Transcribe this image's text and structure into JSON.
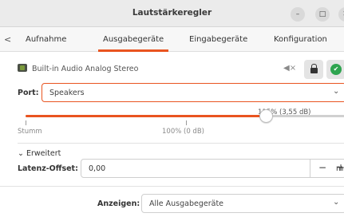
{
  "window": {
    "title": "Lautstärkeregler",
    "minimize_icon": "–",
    "maximize_icon": "□",
    "close_icon": "✕"
  },
  "tabs": {
    "scroll_left": "<",
    "items": [
      {
        "label": "Aufnahme"
      },
      {
        "label": "Ausgabegeräte",
        "active": true
      },
      {
        "label": "Eingabegeräte"
      },
      {
        "label": "Konfiguration"
      }
    ]
  },
  "device": {
    "name": "Built-in Audio Analog Stereo",
    "mute_icon": "speaker-muted-icon",
    "lock_icon": "lock-icon",
    "default_icon": "check-icon",
    "check_glyph": "✔"
  },
  "port": {
    "label": "Port:",
    "value": "Speakers",
    "chevron": "⌄"
  },
  "volume": {
    "percent_label": "115% (3,55 dB)",
    "level_percent": 115,
    "max_percent": 153,
    "mark_left": "Stumm",
    "mark_mid": "100% (0 dB)"
  },
  "advanced": {
    "label": "Erweitert",
    "chevron": "⌄"
  },
  "latency": {
    "label": "Latenz-Offset:",
    "value": "0,00",
    "minus": "−",
    "plus": "+",
    "unit": "m"
  },
  "footer": {
    "show_label": "Anzeigen:",
    "show_value": "Alle Ausgabegeräte",
    "chevron": "⌄"
  },
  "colors": {
    "accent": "#e95420",
    "success": "#2ea44f"
  }
}
